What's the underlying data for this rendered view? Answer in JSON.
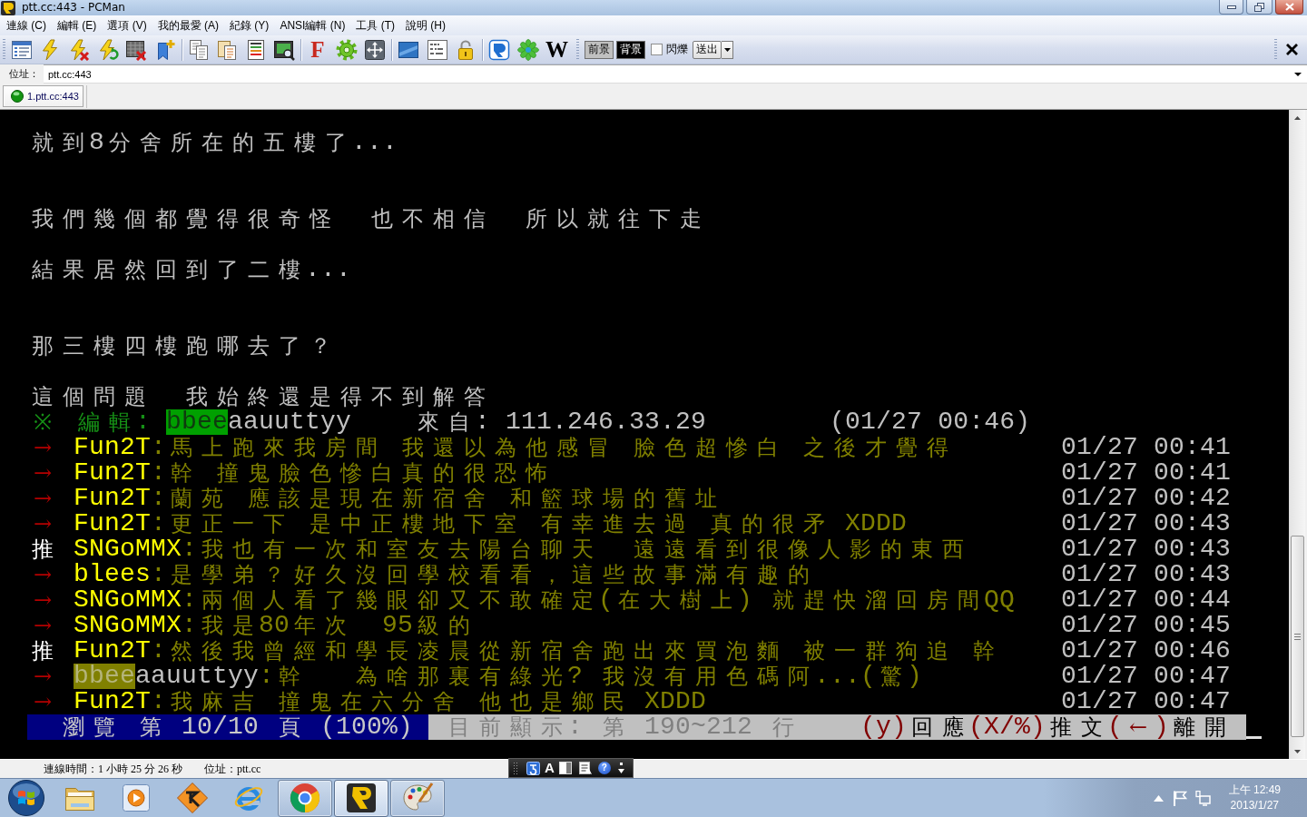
{
  "window": {
    "title": "ptt.cc:443 - PCMan"
  },
  "menu_bar": [
    "連線 (C)",
    "編輯 (E)",
    "選項 (V)",
    "我的最愛 (A)",
    "紀錄 (Y)",
    "ANSI編輯 (N)",
    "工具 (T)",
    "說明 (H)"
  ],
  "toolbar": {
    "glyph_buttons": [
      "F",
      "W"
    ],
    "color_buttons": [
      {
        "label": "前景",
        "color": "#c0c0c0"
      },
      {
        "label": "背景",
        "color": "#000000"
      }
    ],
    "blink_checkbox": {
      "label": "閃爍",
      "checked": false
    },
    "send_button": "送出"
  },
  "address_bar": {
    "label": "位址：",
    "value": "ptt.cc:443"
  },
  "tabs": [
    {
      "label": "1.ptt.cc:443",
      "selected": true
    }
  ],
  "terminal": {
    "article_rows": [
      {
        "kind": "text",
        "text": "就到8分舍所在的五樓了..."
      },
      {
        "kind": "blank"
      },
      {
        "kind": "blank"
      },
      {
        "kind": "text",
        "text": "我們幾個都覺得很奇怪  也不相信  所以就往下走"
      },
      {
        "kind": "blank"
      },
      {
        "kind": "text",
        "text": "結果居然回到了二樓..."
      },
      {
        "kind": "blank"
      },
      {
        "kind": "blank"
      },
      {
        "kind": "text",
        "text": "那三樓四樓跑哪去了？"
      },
      {
        "kind": "blank"
      },
      {
        "kind": "text",
        "text": "這個問題  我始終還是得不到解答"
      }
    ],
    "edit_note": {
      "mark": "※",
      "label": "編輯:",
      "editor": [
        {
          "kind": "highlight",
          "text": "bbee",
          "color": "#00a000"
        },
        {
          "kind": "plain",
          "text": "aauuttyy",
          "color": "#c0c0c0"
        }
      ],
      "origin": "來自: 111.246.33.29",
      "time": "(01/27 00:46)"
    },
    "comments": [
      {
        "kind": "comment",
        "mark": "→",
        "user": [
          {
            "kind": "plain",
            "text": "Fun2T",
            "color": "#ffff00"
          }
        ],
        "text": ":馬上跑來我房間 我還以為他感冒 臉色超慘白 之後才覺得",
        "time": "01/27 00:41"
      },
      {
        "kind": "comment",
        "mark": "→",
        "user": [
          {
            "kind": "plain",
            "text": "Fun2T",
            "color": "#ffff00"
          }
        ],
        "text": ":幹 撞鬼臉色慘白真的很恐怖",
        "time": "01/27 00:41"
      },
      {
        "kind": "comment",
        "mark": "→",
        "user": [
          {
            "kind": "plain",
            "text": "Fun2T",
            "color": "#ffff00"
          }
        ],
        "text": ":蘭苑 應該是現在新宿舍 和籃球場的舊址",
        "time": "01/27 00:42"
      },
      {
        "kind": "comment",
        "mark": "→",
        "user": [
          {
            "kind": "plain",
            "text": "Fun2T",
            "color": "#ffff00"
          }
        ],
        "text": ":更正一下 是中正樓地下室 有幸進去過 真的很矛 XDDD",
        "time": "01/27 00:43"
      },
      {
        "kind": "push",
        "mark": "推",
        "user": [
          {
            "kind": "plain",
            "text": "SNGoMMX",
            "color": "#ffff00"
          }
        ],
        "text": ":我也有一次和室友去陽台聊天  遠遠看到很像人影的東西",
        "time": "01/27 00:43"
      },
      {
        "kind": "comment",
        "mark": "→",
        "user": [
          {
            "kind": "plain",
            "text": "blees",
            "color": "#ffff00"
          }
        ],
        "text": ":是學弟？好久沒回學校看看，這些故事滿有趣的",
        "time": "01/27 00:43"
      },
      {
        "kind": "comment",
        "mark": "→",
        "user": [
          {
            "kind": "plain",
            "text": "SNGoMMX",
            "color": "#ffff00"
          }
        ],
        "text": ":兩個人看了幾眼卻又不敢確定(在大樹上) 就趕快溜回房間QQ",
        "time": "01/27 00:44"
      },
      {
        "kind": "comment",
        "mark": "→",
        "user": [
          {
            "kind": "plain",
            "text": "SNGoMMX",
            "color": "#ffff00"
          }
        ],
        "text": ":我是80年次  95級的",
        "time": "01/27 00:45"
      },
      {
        "kind": "push",
        "mark": "推",
        "user": [
          {
            "kind": "plain",
            "text": "Fun2T",
            "color": "#ffff00"
          }
        ],
        "text": ":然後我曾經和學長凌晨從新宿舍跑出來買泡麵 被一群狗追 幹",
        "time": "01/27 00:46"
      },
      {
        "kind": "comment",
        "mark": "→",
        "user": [
          {
            "kind": "highlight",
            "text": "bbee",
            "color": "#808000"
          },
          {
            "kind": "plain",
            "text": "aauuttyy",
            "color": "#c0c0c0"
          }
        ],
        "text": ":幹   為啥那裏有綠光? 我沒有用色碼阿...(驚)",
        "time": "01/27 00:47"
      },
      {
        "kind": "comment",
        "mark": "→",
        "user": [
          {
            "kind": "plain",
            "text": "Fun2T",
            "color": "#ffff00"
          }
        ],
        "text": ":我麻吉 撞鬼在六分舍 他也是鄉民 XDDD",
        "time": "01/27 00:47"
      }
    ],
    "footer": {
      "page_info": "瀏覽 第 10/10 頁 (100%)",
      "line_info": "目前顯示: 第 190~212 行",
      "hints": [
        {
          "key": "(y)",
          "label": "回應"
        },
        {
          "key": "(X/%)",
          "label": "推文"
        },
        {
          "key": "(←)",
          "label": "離開"
        }
      ]
    }
  },
  "status_bar": {
    "connection_time": "連線時間：1 小時 25 分 26 秒",
    "address": "位址：ptt.cc"
  },
  "language_bar": {
    "glyphs": [
      "A",
      "?"
    ]
  },
  "taskbar": {
    "apps": [
      {
        "kind": "folder",
        "running": false,
        "selected": false
      },
      {
        "kind": "player",
        "running": false,
        "selected": false
      },
      {
        "kind": "diamond",
        "running": false,
        "selected": false
      },
      {
        "kind": "ering",
        "running": false,
        "selected": false
      },
      {
        "kind": "wheel",
        "running": true,
        "selected": false
      },
      {
        "kind": "plogo",
        "running": true,
        "selected": true
      },
      {
        "kind": "palette",
        "running": true,
        "selected": false
      }
    ],
    "clock": {
      "time": "上午 12:49",
      "date": "2013/1/27"
    }
  }
}
